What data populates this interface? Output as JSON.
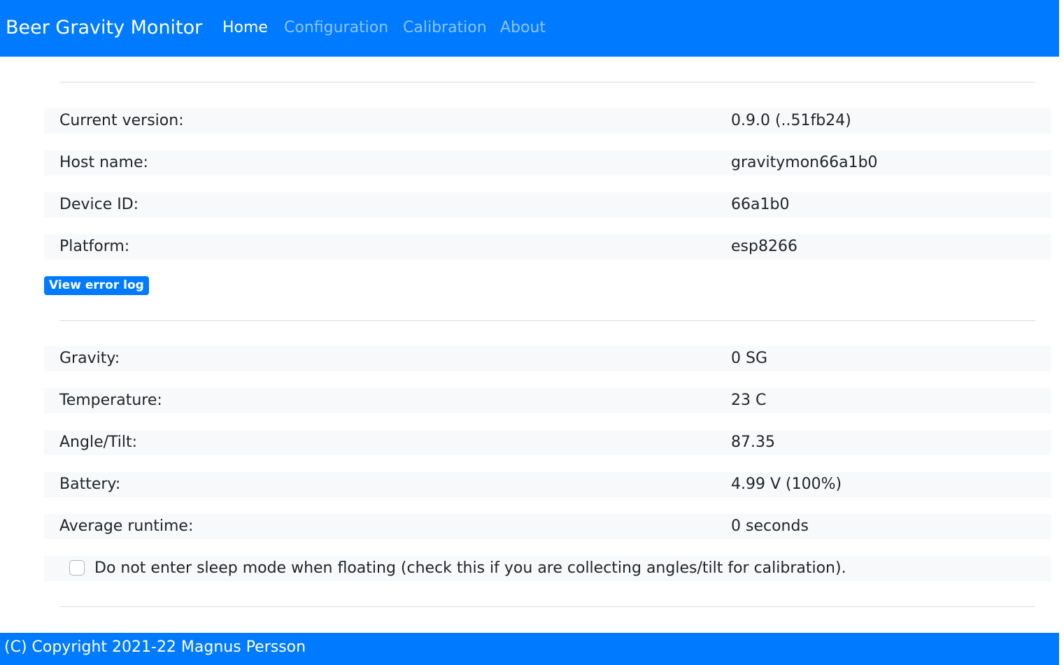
{
  "navbar": {
    "brand": "Beer Gravity Monitor",
    "links": [
      {
        "label": "Home",
        "active": true
      },
      {
        "label": "Configuration",
        "active": false
      },
      {
        "label": "Calibration",
        "active": false
      },
      {
        "label": "About",
        "active": false
      }
    ]
  },
  "device_info": [
    {
      "label": "Current version:",
      "value": "0.9.0 (..51fb24)"
    },
    {
      "label": "Host name:",
      "value": "gravitymon66a1b0"
    },
    {
      "label": "Device ID:",
      "value": "66a1b0"
    },
    {
      "label": "Platform:",
      "value": "esp8266"
    }
  ],
  "error_log_button": "View error log",
  "measurements": [
    {
      "label": "Gravity:",
      "value": "0 SG"
    },
    {
      "label": "Temperature:",
      "value": "23 C"
    },
    {
      "label": "Angle/Tilt:",
      "value": "87.35"
    },
    {
      "label": "Battery:",
      "value": "4.99 V (100%)"
    },
    {
      "label": "Average runtime:",
      "value": "0 seconds"
    }
  ],
  "sleep_mode": {
    "label": "Do not enter sleep mode when floating (check this if you are collecting angles/tilt for calibration).",
    "checked": false
  },
  "footer": {
    "text": "(C) Copyright 2021-22 Magnus Persson"
  },
  "colors": {
    "primary": "#007bff",
    "row_background": "#f8f9fa"
  }
}
